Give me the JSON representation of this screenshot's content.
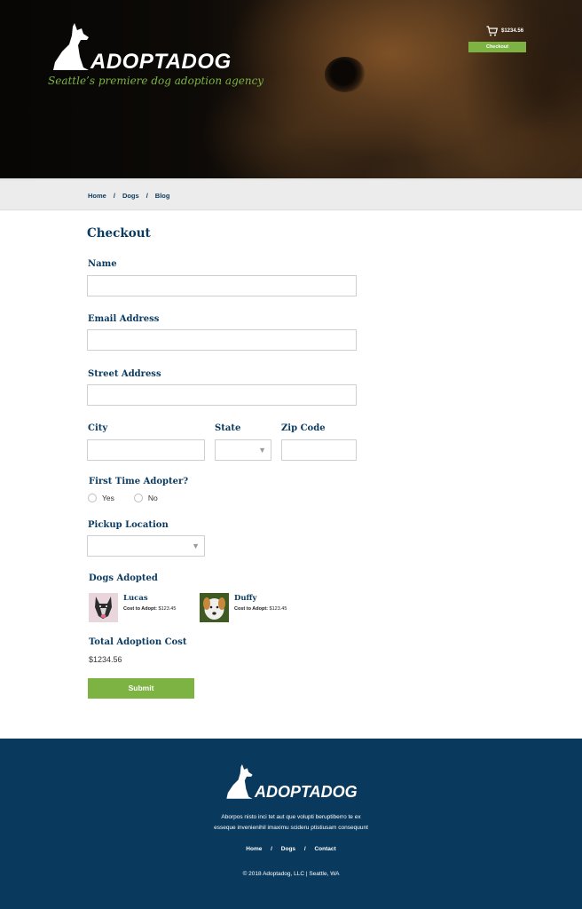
{
  "brand": {
    "name": "ADOPTADOG",
    "tagline": "Seattle’s premiere dog adoption agency"
  },
  "header": {
    "cart_total": "$1234.56",
    "checkout_label": "Checkout"
  },
  "breadcrumb": {
    "items": [
      {
        "label": "Home"
      },
      {
        "label": "Dogs"
      },
      {
        "label": "Blog"
      }
    ],
    "separator": "/"
  },
  "form": {
    "title": "Checkout",
    "name_label": "Name",
    "email_label": "Email Address",
    "street_label": "Street Address",
    "city_label": "City",
    "state_label": "State",
    "zip_label": "Zip Code",
    "first_time_label": "First Time Adopter?",
    "yes_label": "Yes",
    "no_label": "No",
    "pickup_label": "Pickup Location",
    "dogs_label": "Dogs Adopted",
    "total_label": "Total Adoption Cost",
    "total_value": "$1234.56",
    "submit_label": "Submit"
  },
  "dogs": [
    {
      "name": "Lucas",
      "cost_label": "Cost to Adopt:",
      "cost": "$123.45"
    },
    {
      "name": "Duffy",
      "cost_label": "Cost to Adopt:",
      "cost": "$123.45"
    }
  ],
  "footer": {
    "brand": "ADOPTADOG",
    "text_line1": "Aborpos nisto inci tet aut que volupti beruptiberro te ex",
    "text_line2": "esseque invenienihil imaximu scideru ptistiusam consequunt",
    "links": [
      {
        "label": "Home"
      },
      {
        "label": "Dogs"
      },
      {
        "label": "Contact"
      }
    ],
    "separator": "/",
    "copyright": "© 2018 Adoptadog, LLC   |   Seattle, WA"
  },
  "colors": {
    "accent_green": "#7cb342",
    "navy": "#0a3a5f",
    "footer_bg": "#093a5e"
  }
}
